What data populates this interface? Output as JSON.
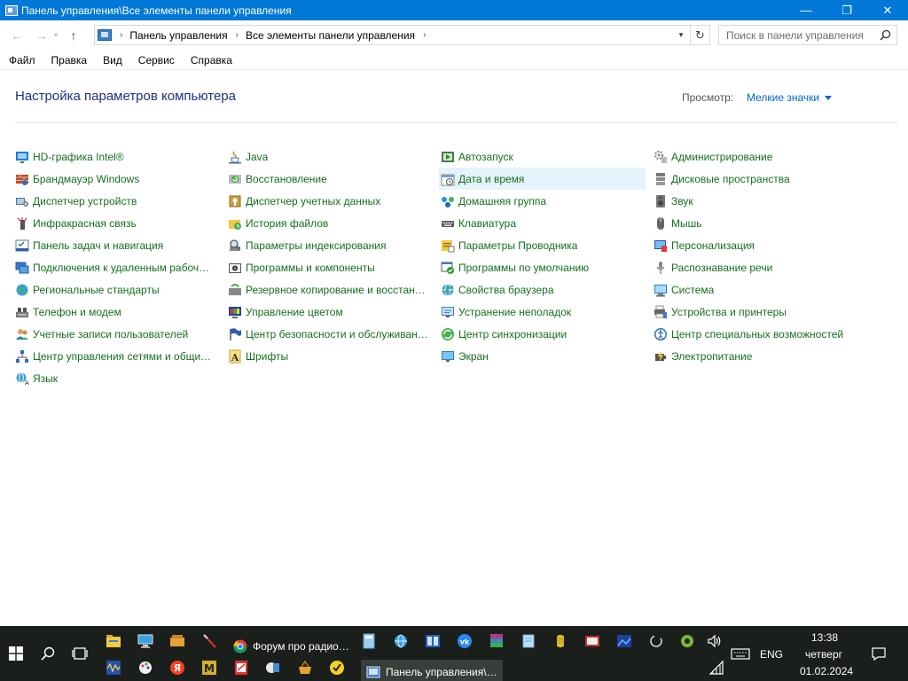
{
  "window": {
    "title": "Панель управления\\Все элементы панели управления",
    "minimize": "—",
    "maximize": "❐",
    "close": "✕"
  },
  "nav": {
    "back": "←",
    "forward": "→",
    "recent": "▾",
    "up": "↑"
  },
  "address": {
    "crumbs": [
      "Панель управления",
      "Все элементы панели управления"
    ],
    "separator": "›"
  },
  "search": {
    "placeholder": "Поиск в панели управления"
  },
  "menu": [
    "Файл",
    "Правка",
    "Вид",
    "Сервис",
    "Справка"
  ],
  "content": {
    "title": "Настройка параметров компьютера",
    "view_label": "Просмотр:",
    "view_value": "Мелкие значки"
  },
  "columns": [
    [
      {
        "label": "HD-графика Intel®",
        "icon": "intel-graphics-icon"
      },
      {
        "label": "Брандмауэр Windows",
        "icon": "firewall-icon"
      },
      {
        "label": "Диспетчер устройств",
        "icon": "device-manager-icon"
      },
      {
        "label": "Инфракрасная связь",
        "icon": "infrared-icon"
      },
      {
        "label": "Панель задач и навигация",
        "icon": "taskbar-icon"
      },
      {
        "label": "Подключения к удаленным рабоч…",
        "icon": "remote-desktop-icon"
      },
      {
        "label": "Региональные стандарты",
        "icon": "region-icon"
      },
      {
        "label": "Телефон и модем",
        "icon": "phone-modem-icon"
      },
      {
        "label": "Учетные записи пользователей",
        "icon": "user-accounts-icon"
      },
      {
        "label": "Центр управления сетями и общи…",
        "icon": "network-center-icon"
      },
      {
        "label": "Язык",
        "icon": "language-icon"
      }
    ],
    [
      {
        "label": "Java",
        "icon": "java-icon"
      },
      {
        "label": "Восстановление",
        "icon": "recovery-icon"
      },
      {
        "label": "Диспетчер учетных данных",
        "icon": "credential-manager-icon"
      },
      {
        "label": "История файлов",
        "icon": "file-history-icon"
      },
      {
        "label": "Параметры индексирования",
        "icon": "indexing-icon"
      },
      {
        "label": "Программы и компоненты",
        "icon": "programs-icon"
      },
      {
        "label": "Резервное копирование и восстан…",
        "icon": "backup-icon"
      },
      {
        "label": "Управление цветом",
        "icon": "color-management-icon"
      },
      {
        "label": "Центр безопасности и обслуживан…",
        "icon": "security-flag-icon"
      },
      {
        "label": "Шрифты",
        "icon": "fonts-icon"
      }
    ],
    [
      {
        "label": "Автозапуск",
        "icon": "autoplay-icon"
      },
      {
        "label": "Дата и время",
        "icon": "date-time-icon"
      },
      {
        "label": "Домашняя группа",
        "icon": "homegroup-icon"
      },
      {
        "label": "Клавиатура",
        "icon": "keyboard-icon"
      },
      {
        "label": "Параметры Проводника",
        "icon": "explorer-options-icon"
      },
      {
        "label": "Программы по умолчанию",
        "icon": "default-programs-icon"
      },
      {
        "label": "Свойства браузера",
        "icon": "internet-options-icon"
      },
      {
        "label": "Устранение неполадок",
        "icon": "troubleshooting-icon"
      },
      {
        "label": "Центр синхронизации",
        "icon": "sync-center-icon"
      },
      {
        "label": "Экран",
        "icon": "display-icon"
      }
    ],
    [
      {
        "label": "Администрирование",
        "icon": "administrative-tools-icon"
      },
      {
        "label": "Дисковые пространства",
        "icon": "storage-spaces-icon"
      },
      {
        "label": "Звук",
        "icon": "sound-icon"
      },
      {
        "label": "Мышь",
        "icon": "mouse-icon"
      },
      {
        "label": "Персонализация",
        "icon": "personalization-icon"
      },
      {
        "label": "Распознавание речи",
        "icon": "speech-recognition-icon"
      },
      {
        "label": "Система",
        "icon": "system-icon"
      },
      {
        "label": "Устройства и принтеры",
        "icon": "devices-printers-icon"
      },
      {
        "label": "Центр специальных возможностей",
        "icon": "ease-of-access-icon"
      },
      {
        "label": "Электропитание",
        "icon": "power-options-icon"
      }
    ]
  ],
  "taskbar": {
    "tasks": [
      {
        "label": "Форум про радио…",
        "icon": "chrome-icon"
      },
      {
        "label": "Панель управления\\…",
        "icon": "control-panel-icon"
      }
    ],
    "language": "ENG",
    "time": "13:38",
    "weekday": "четверг",
    "date": "01.02.2024"
  },
  "colors": {
    "titlebar": "#0078d7",
    "link": "#166e1f",
    "heading": "#1e3287",
    "view_link": "#0066cc",
    "hover": "#e5f3fb",
    "taskbar": "#1b1f1b"
  }
}
